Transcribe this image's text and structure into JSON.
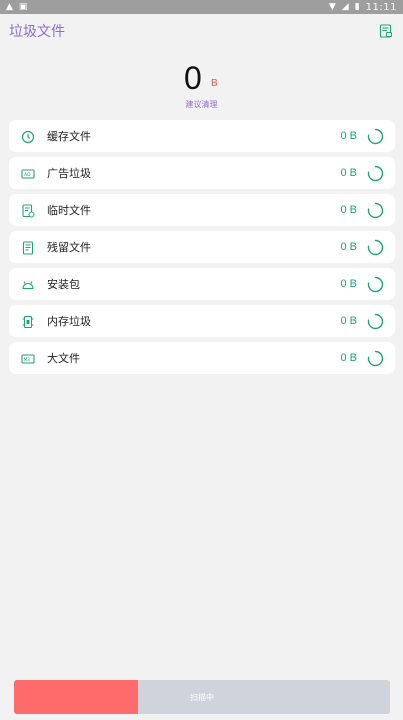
{
  "status_bar": {
    "time": "11:11"
  },
  "app_bar": {
    "title": "垃圾文件"
  },
  "summary": {
    "size_value": "0",
    "size_unit": "B",
    "hint": "建议清理"
  },
  "colors": {
    "accent_purple": "#8a6fc9",
    "accent_green": "#1fa37a",
    "accent_red": "#ff6b6b"
  },
  "categories": [
    {
      "label": "缓存文件",
      "size": "0 B",
      "icon": "clock-icon"
    },
    {
      "label": "广告垃圾",
      "size": "0 B",
      "icon": "ad-icon"
    },
    {
      "label": "临时文件",
      "size": "0 B",
      "icon": "temp-file-icon"
    },
    {
      "label": "残留文件",
      "size": "0 B",
      "icon": "residual-file-icon"
    },
    {
      "label": "安装包",
      "size": "0 B",
      "icon": "android-apk-icon"
    },
    {
      "label": "内存垃圾",
      "size": "0 B",
      "icon": "memory-chip-icon"
    },
    {
      "label": "大文件",
      "size": "0 B",
      "icon": "large-file-icon"
    }
  ],
  "scan_button": {
    "label": "扫描中",
    "progress": 0.33
  }
}
